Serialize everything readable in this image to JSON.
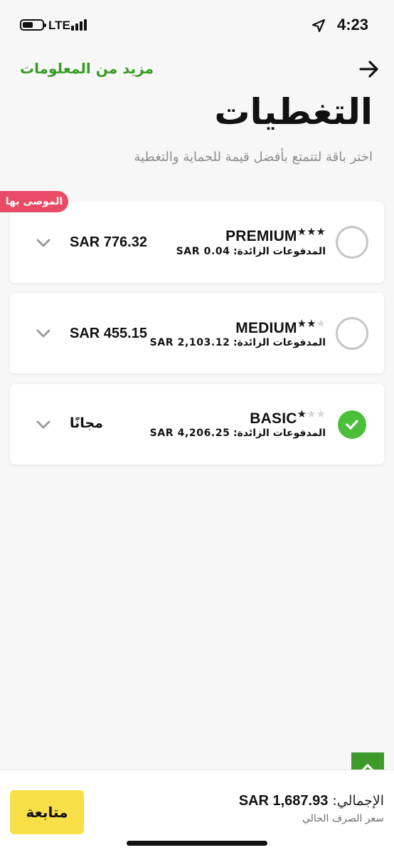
{
  "status_bar": {
    "network": "LTE",
    "time": "4:23"
  },
  "header": {
    "more_info": "مزيد من المعلومات",
    "title": "التغطيات",
    "subtitle": "اختر باقة لتتمتع بأفضل قيمة للحماية والتغطية"
  },
  "recommended_badge": "الموصى بها",
  "plans": [
    {
      "name": "PREMIUM",
      "stars_filled": 3,
      "stars_total": 3,
      "excess_label": "المدفوعات الزائدة:",
      "excess_amount": "SAR 0.04",
      "price": "SAR 776.32",
      "selected": false
    },
    {
      "name": "MEDIUM",
      "stars_filled": 2,
      "stars_total": 3,
      "excess_label": "المدفوعات الزائدة:",
      "excess_amount": "SAR 2,103.12",
      "price": "SAR 455.15",
      "selected": false
    },
    {
      "name": "BASIC",
      "stars_filled": 1,
      "stars_total": 3,
      "excess_label": "المدفوعات الزائدة:",
      "excess_amount": "SAR 4,206.25",
      "price": "مجانًا",
      "selected": true
    }
  ],
  "footer": {
    "total_label": "الإجمالي:",
    "total_value": "SAR 1,687.93",
    "rate_note": "سعر الصرف الحالي",
    "continue_label": "متابعة"
  },
  "colors": {
    "accent_green": "#3a9a25",
    "badge_red": "#e94b66",
    "button_yellow": "#f7df48",
    "check_green": "#4bbf3a"
  }
}
